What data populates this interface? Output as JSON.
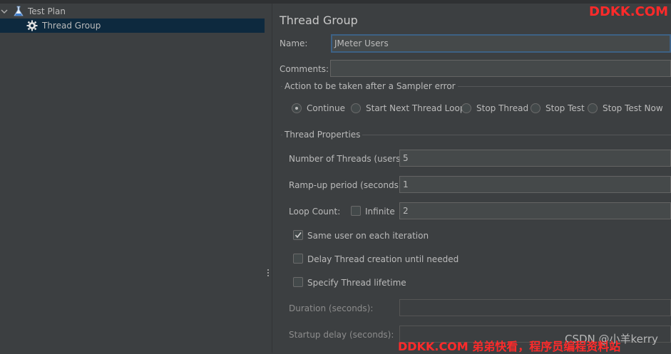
{
  "tree": {
    "items": [
      {
        "label": "Test Plan",
        "icon": "flask-icon",
        "expanded": true
      },
      {
        "label": "Thread Group",
        "icon": "gear-icon",
        "selected": true
      }
    ]
  },
  "panel": {
    "title": "Thread Group",
    "name_label": "Name:",
    "name_value": "JMeter Users",
    "comments_label": "Comments:",
    "comments_value": "",
    "action_group_title": "Action to be taken after a Sampler error",
    "actions": [
      {
        "label": "Continue",
        "selected": true
      },
      {
        "label": "Start Next Thread Loop",
        "selected": false
      },
      {
        "label": "Stop Thread",
        "selected": false
      },
      {
        "label": "Stop Test",
        "selected": false
      },
      {
        "label": "Stop Test Now",
        "selected": false
      }
    ],
    "props_group_title": "Thread Properties",
    "threads_label": "Number of Threads (users):",
    "threads_value": "5",
    "rampup_label": "Ramp-up period (seconds):",
    "rampup_value": "1",
    "loop_label": "Loop Count:",
    "infinite_label": "Infinite",
    "infinite_checked": false,
    "loop_value": "2",
    "same_user_label": "Same user on each iteration",
    "same_user_checked": true,
    "delay_label": "Delay Thread creation until needed",
    "delay_checked": false,
    "lifetime_label": "Specify Thread lifetime",
    "lifetime_checked": false,
    "duration_label": "Duration (seconds):",
    "duration_value": "",
    "startup_label": "Startup delay (seconds):",
    "startup_value": ""
  },
  "watermarks": {
    "top_right": "DDKK.COM",
    "bottom": "DDKK.COM 弟弟快看，程序员编程资料站",
    "csdn": "CSDN @小羊kerry"
  },
  "colors": {
    "background": "#3c3f41",
    "selection": "#0d293e",
    "focus_border": "#3d6185",
    "watermark": "#ff2a2a"
  }
}
